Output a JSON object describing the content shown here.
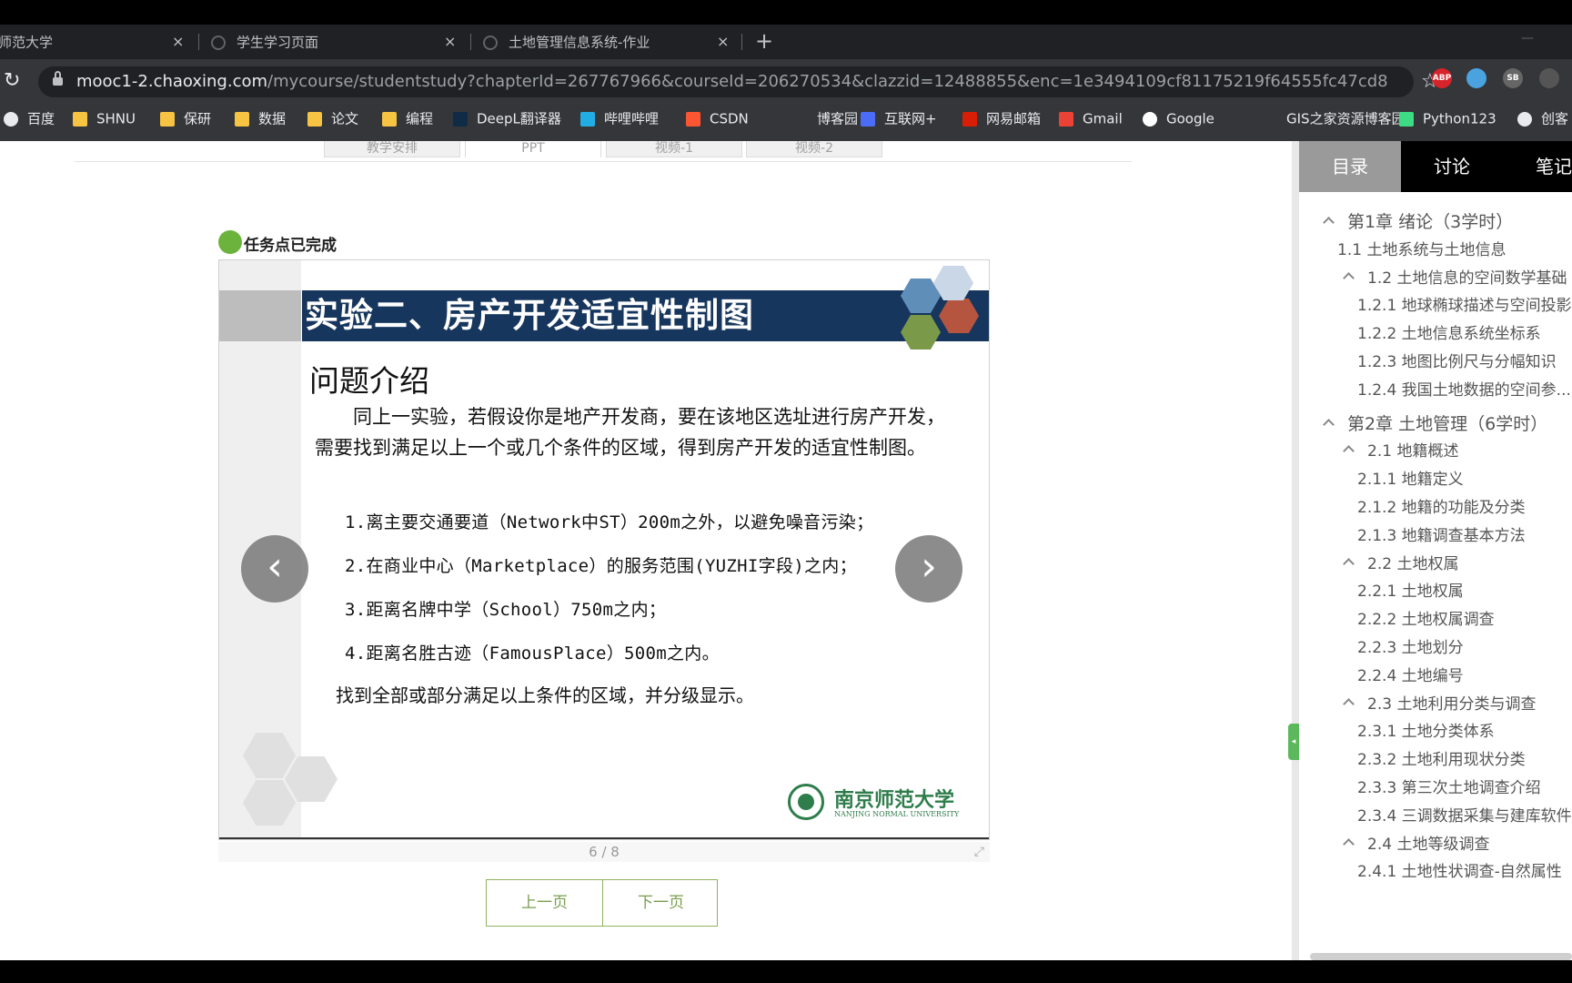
{
  "browser": {
    "tabs": [
      {
        "title": "师范大学"
      },
      {
        "title": "学生学习页面"
      },
      {
        "title": "土地管理信息系统-作业"
      }
    ],
    "tab_close": "×",
    "new_tab": "+",
    "url_host": "mooc1-2.chaoxing.com",
    "url_path": "/mycourse/studentstudy?chapterId=267767966&courseId=206270534&clazzid=12488855&enc=1e3494109cf81175219f64555fc47cd8",
    "extensions": [
      {
        "label": "ABP",
        "color": "#d8232a"
      },
      {
        "label": "",
        "color": "#4aa3df"
      },
      {
        "label": "SB",
        "color": "#666666"
      },
      {
        "label": "",
        "color": "#555555"
      }
    ],
    "bookmarks": [
      {
        "label": "百度",
        "icon": "globe-icon",
        "color": "#e8eaed"
      },
      {
        "label": "SHNU",
        "icon": "folder-icon",
        "color": "#f6c342"
      },
      {
        "label": "保研",
        "icon": "folder-icon",
        "color": "#f6c342"
      },
      {
        "label": "数据",
        "icon": "folder-icon",
        "color": "#f6c342"
      },
      {
        "label": "论文",
        "icon": "folder-icon",
        "color": "#f6c342"
      },
      {
        "label": "编程",
        "icon": "folder-icon",
        "color": "#f6c342"
      },
      {
        "label": "DeepL翻译器",
        "icon": "deepl-icon",
        "color": "#0f2b46"
      },
      {
        "label": "哔哩哔哩",
        "icon": "bilibili-icon",
        "color": "#23ade5"
      },
      {
        "label": "CSDN",
        "icon": "csdn-icon",
        "color": "#fc5531"
      },
      {
        "label": "博客园",
        "icon": "blog-icon",
        "color": "#35363a"
      },
      {
        "label": "互联网+",
        "icon": "internet-plus-icon",
        "color": "#4a6cf7"
      },
      {
        "label": "网易邮箱",
        "icon": "netease-icon",
        "color": "#d81e06"
      },
      {
        "label": "Gmail",
        "icon": "gmail-icon",
        "color": "#ea4335"
      },
      {
        "label": "Google",
        "icon": "google-icon",
        "color": "#ffffff"
      },
      {
        "label": "GIS之家资源博客园",
        "icon": "gis-icon",
        "color": "#35363a"
      },
      {
        "label": "Python123",
        "icon": "python123-icon",
        "color": "#3ddc84"
      },
      {
        "label": "创客",
        "icon": "globe-icon",
        "color": "#e8eaed"
      }
    ]
  },
  "content_tabs": [
    "教学安排",
    "PPT",
    "视频-1",
    "视频-2"
  ],
  "task_status": "任务点已完成",
  "slide": {
    "title": "实验二、房产开发适宜性制图",
    "heading": "问题介绍",
    "intro": "同上一实验，若假设你是地产开发商，要在该地区选址进行房产开发，需要找到满足以上一个或几个条件的区域，得到房产开发的适宜性制图。",
    "conditions": [
      "1.离主要交通要道（Network中ST）200m之外，以避免噪音污染；",
      "2.在商业中心（Marketplace）的服务范围(YUZHI字段)之内；",
      "3.距离名牌中学（School）750m之内；",
      "4.距离名胜古迹（FamousPlace）500m之内。"
    ],
    "summary": "找到全部或部分满足以上条件的区域，并分级显示。",
    "university_name": "南京师范大学",
    "university_en": "NANJING NORMAL UNIVERSITY",
    "banner_color": "#17365d"
  },
  "viewer": {
    "page_indicator": "6 / 8",
    "prev_arrow": "‹",
    "next_arrow": "›",
    "prev_page": "上一页",
    "next_page": "下一页"
  },
  "sidebar": {
    "tabs": [
      "目录",
      "讨论",
      "笔记"
    ],
    "toc": [
      {
        "label": "第1章 绪论（3学时）",
        "level": 0,
        "chevron": true
      },
      {
        "label": "1.1 土地系统与土地信息",
        "level": 1,
        "chevron": false
      },
      {
        "label": "1.2 土地信息的空间数学基础",
        "level": 2,
        "chevron": true
      },
      {
        "label": "1.2.1 地球椭球描述与空间投影",
        "level": 3,
        "chevron": false
      },
      {
        "label": "1.2.2 土地信息系统坐标系",
        "level": 3,
        "chevron": false
      },
      {
        "label": "1.2.3 地图比例尺与分幅知识",
        "level": 3,
        "chevron": false
      },
      {
        "label": "1.2.4 我国土地数据的空间参...",
        "level": 3,
        "chevron": false
      },
      {
        "label": "第2章 土地管理（6学时）",
        "level": 0,
        "chevron": true
      },
      {
        "label": "2.1 地籍概述",
        "level": 2,
        "chevron": true
      },
      {
        "label": "2.1.1 地籍定义",
        "level": 3,
        "chevron": false
      },
      {
        "label": "2.1.2 地籍的功能及分类",
        "level": 3,
        "chevron": false
      },
      {
        "label": "2.1.3 地籍调查基本方法",
        "level": 3,
        "chevron": false
      },
      {
        "label": "2.2 土地权属",
        "level": 2,
        "chevron": true
      },
      {
        "label": "2.2.1 土地权属",
        "level": 3,
        "chevron": false
      },
      {
        "label": "2.2.2 土地权属调查",
        "level": 3,
        "chevron": false
      },
      {
        "label": "2.2.3 土地划分",
        "level": 3,
        "chevron": false
      },
      {
        "label": "2.2.4 土地编号",
        "level": 3,
        "chevron": false
      },
      {
        "label": "2.3 土地利用分类与调查",
        "level": 2,
        "chevron": true
      },
      {
        "label": "2.3.1 土地分类体系",
        "level": 3,
        "chevron": false
      },
      {
        "label": "2.3.2 土地利用现状分类",
        "level": 3,
        "chevron": false
      },
      {
        "label": "2.3.3 第三次土地调查介绍",
        "level": 3,
        "chevron": false
      },
      {
        "label": "2.3.4 三调数据采集与建库软件",
        "level": 3,
        "chevron": false
      },
      {
        "label": "2.4 土地等级调查",
        "level": 2,
        "chevron": true
      },
      {
        "label": "2.4.1 土地性状调查-自然属性",
        "level": 3,
        "chevron": false
      }
    ]
  }
}
